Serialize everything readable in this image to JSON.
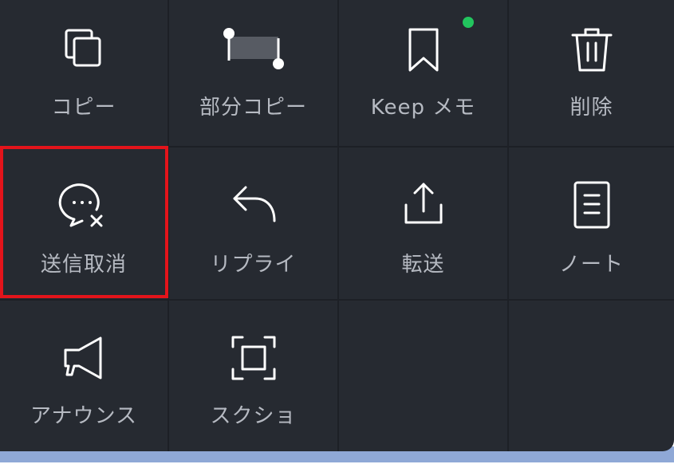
{
  "menu": {
    "items": [
      {
        "label": "コピー",
        "icon": "copy-icon"
      },
      {
        "label": "部分コピー",
        "icon": "partial-copy-icon"
      },
      {
        "label": "Keep メモ",
        "icon": "bookmark-icon"
      },
      {
        "label": "削除",
        "icon": "trash-icon"
      },
      {
        "label": "送信取消",
        "icon": "unsend-message-icon"
      },
      {
        "label": "リプライ",
        "icon": "reply-arrow-icon"
      },
      {
        "label": "転送",
        "icon": "share-upload-icon"
      },
      {
        "label": "ノート",
        "icon": "note-document-icon"
      },
      {
        "label": "アナウンス",
        "icon": "megaphone-icon"
      },
      {
        "label": "スクショ",
        "icon": "screenshot-frame-icon"
      }
    ],
    "keep_badge": "new-indicator",
    "highlighted_item": "送信取消"
  },
  "colors": {
    "panel_background": "#262a31",
    "label_text": "#b6bac2",
    "icon_stroke": "#ffffff",
    "badge_green": "#22c55e",
    "highlight_red": "#e3141b",
    "bottom_strip": "#8fa8d6"
  }
}
